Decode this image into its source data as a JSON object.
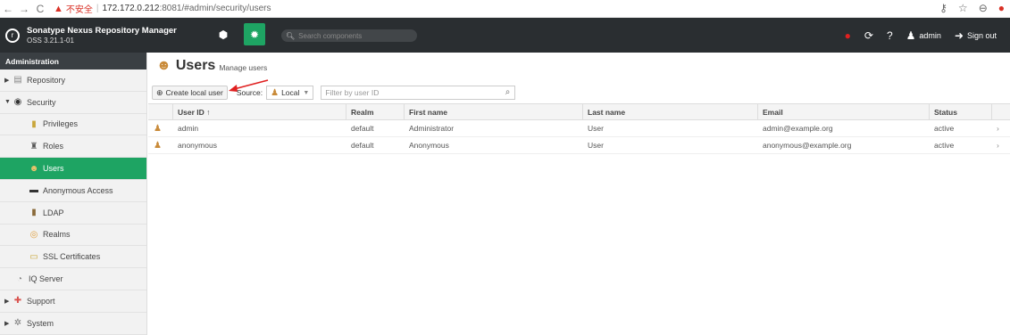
{
  "browser": {
    "insecure_label": "不安全",
    "url_host": "172.172.0.212",
    "url_path": ":8081/#admin/security/users"
  },
  "app": {
    "title": "Sonatype Nexus Repository Manager",
    "version": "OSS 3.21.1-01",
    "search_placeholder": "Search components",
    "user": "admin",
    "signout": "Sign out"
  },
  "sidebar": {
    "header": "Administration",
    "items": [
      {
        "label": "Repository",
        "icon": "database-icon"
      },
      {
        "label": "Security",
        "icon": "shield-icon"
      },
      {
        "label": "Privileges",
        "icon": "privilege-icon"
      },
      {
        "label": "Roles",
        "icon": "role-icon"
      },
      {
        "label": "Users",
        "icon": "users-icon"
      },
      {
        "label": "Anonymous Access",
        "icon": "card-icon"
      },
      {
        "label": "LDAP",
        "icon": "book-icon"
      },
      {
        "label": "Realms",
        "icon": "realm-icon"
      },
      {
        "label": "SSL Certificates",
        "icon": "certificate-icon"
      },
      {
        "label": "IQ Server",
        "icon": "iq-server-icon"
      },
      {
        "label": "Support",
        "icon": "support-icon"
      },
      {
        "label": "System",
        "icon": "system-gear-icon"
      }
    ]
  },
  "page": {
    "title": "Users",
    "subtitle": "Manage users"
  },
  "toolbar": {
    "create_label": "Create local user",
    "source_label": "Source:",
    "source_value": "Local",
    "filter_placeholder": "Filter by user ID"
  },
  "table": {
    "headers": {
      "user_id": "User ID ↑",
      "realm": "Realm",
      "first_name": "First name",
      "last_name": "Last name",
      "email": "Email",
      "status": "Status"
    },
    "rows": [
      {
        "user_id": "admin",
        "realm": "default",
        "first_name": "Administrator",
        "last_name": "User",
        "email": "admin@example.org",
        "status": "active"
      },
      {
        "user_id": "anonymous",
        "realm": "default",
        "first_name": "Anonymous",
        "last_name": "User",
        "email": "anonymous@example.org",
        "status": "active"
      }
    ]
  },
  "colors": {
    "accent": "#1ea463",
    "header_bg": "#2a2e31",
    "alert": "#e02020"
  }
}
